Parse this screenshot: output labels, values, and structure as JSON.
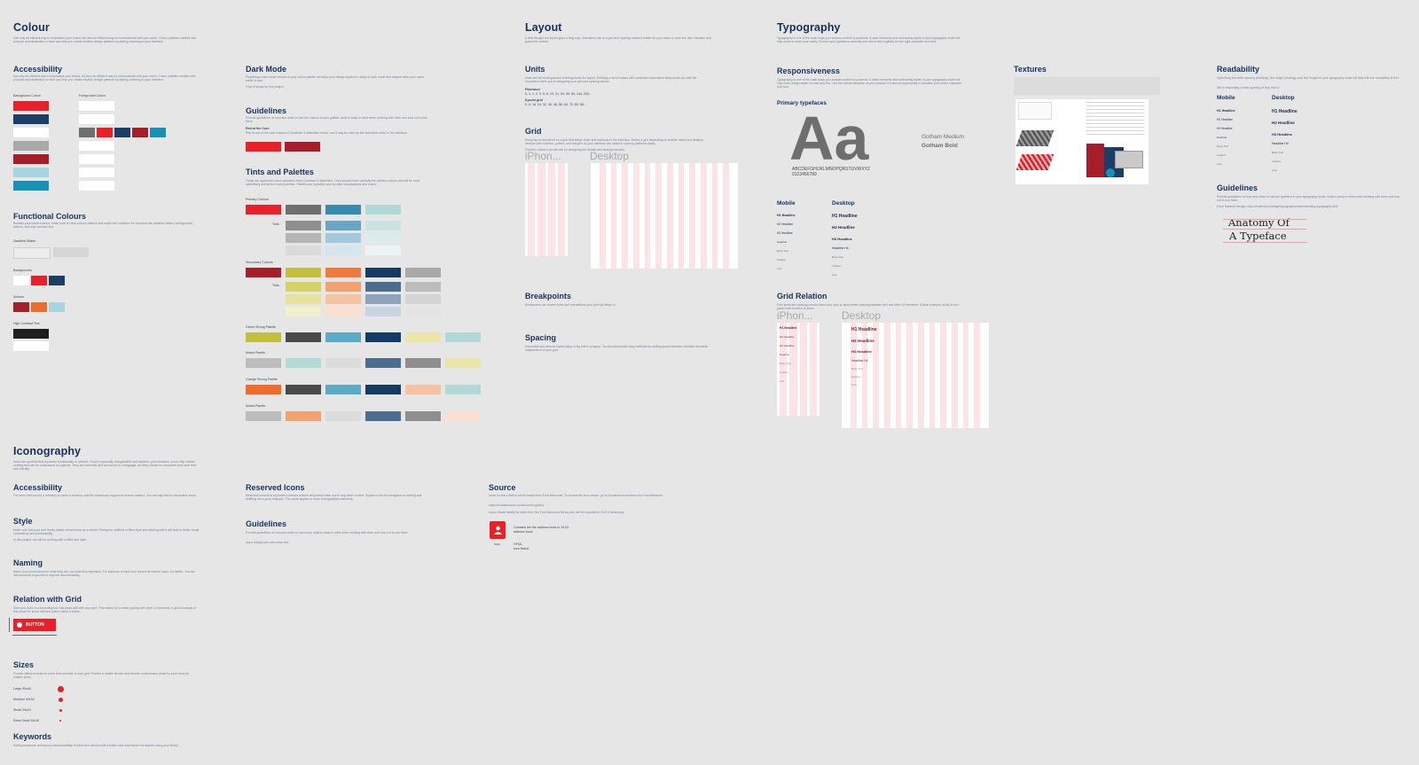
{
  "colour": {
    "title": "Colour",
    "desc": "Use only an efficient way to emphasise your brand, but also an efficient way to communicate with your users. Colour palettes created with purpose and aesthetics in mind can help you create intuitive design patterns by adding meaning to your interface.",
    "accessibility": {
      "title": "Accessibility",
      "desc": "Not only an efficient way to emphasise your brand, but also an efficient way to communicate with your users. Colour palettes created with purpose and aesthetics in mind can help you create intuitive design patterns by adding meaning to your interface.",
      "bg_label": "Background Colour",
      "fg_label": "Foreground Colour",
      "bg_colours": [
        "#e8202a",
        "#1a3e66",
        "#ffffff",
        "#a9a9a9",
        "#a61e2a",
        "#a6d4e0",
        "#1591b6"
      ],
      "combo_colours": [
        "#6f6f6f",
        "#e8202a",
        "#1a3e66",
        "#a61e2a",
        "#1591b6"
      ]
    },
    "functional": {
      "title": "Functional Colours",
      "desc": "Besides your brand colours, make sure to have colours defined and made into variables for functions like disabled states, backgrounds, actions, and high contrast text.",
      "disabled_label": "Disabled States",
      "backgrounds_label": "Backgrounds",
      "actions_label": "Actions",
      "high_contrast_label": "High Contrast Text"
    },
    "dark_mode": {
      "title": "Dark Mode",
      "desc": "Preparing a dark mode version of your colour palette will allow your design system to adapt to dark mode and respect what your users prefer to see.",
      "note": "*Out of scope for this project"
    },
    "guidelines": {
      "title": "Guidelines",
      "desc": "Provide guidelines on how and when to use the colours in your palette, what to keep in mind when working with them and how not to use them.",
      "sub_title": "Red at the Core",
      "sub_desc": "Red is one of the core colours of Cushman & Wakefield brand, and it may be used as the dominant colour in the interface."
    },
    "tints": {
      "title": "Tints and Palettes",
      "desc": "These are approved colour variations from Cushman & Wakefield. They should cover carefully the primary colours and will be most specifically across the brand palettes. Palettes are typically used for data visualisations and charts.",
      "primary_label": "Primary Colours",
      "tints_label": "Tints",
      "secondary_label": "Secondary Colours",
      "tints2_label": "Tints",
      "p1_label": "Green Strong Palette",
      "p2_label": "Muted Palette",
      "p3_label": "Orange Strong Palette",
      "p4_label": "Muted Palette"
    }
  },
  "layout": {
    "title": "Layout",
    "desc": "A well thought out layout goes a long way. Consistent use of a grid and spacing makes it easier for your users to scan the user interface and grasp the content.",
    "units": {
      "title": "Units",
      "desc": "Units are the most granular building blocks for layout. Defining a set of values with consistent increments will provide you with the foundation when you're designing your grid and spacing values.",
      "fib_label": "Fibonacci",
      "fib_values": "0, 1, 1, 2, 3, 5, 8, 13, 21, 34, 55, 89, 144, 233...",
      "base_label": "8-point grid",
      "base_values": "0, 8, 16, 24, 32, 40, 48, 56, 64, 72, 80, 88..."
    },
    "grid": {
      "title": "Grid",
      "desc": "Every layout should sit on a grid that brings order and harmony to the interface. Define a grid depending on mobile, tablet and desktop devices with columns, gutters, and margins so your interface can adapt to various platforms easily.",
      "note": "Find the columns we will use for designing the mobile and desktop devices.",
      "iphone_label": "iPhon...",
      "desktop_label": "Desktop"
    },
    "breakpoints": {
      "title": "Breakpoints",
      "desc": "Breakpoints are screen sizes and orientations your grid will adapt to."
    },
    "spacing": {
      "title": "Spacing",
      "desc": "Horizontal and vertical rhythm plays a big role in a layout. You should provide easy methods for adding space between interface elements independent of your grid."
    }
  },
  "typography": {
    "title": "Typography",
    "desc": "Typography is one of the main ways you surface content to products. A clear hierarchy and contrasting styles in your typography scale will help users to read more easily. Choose your typefaces carefully and check their legibility for the right character and tone.",
    "responsiveness": {
      "title": "Responsiveness",
      "desc": "Typography is one of the main ways you surface content to products. A clear hierarchy and contrasting styles in your typography scale will help make things easier to read and find. Use the overall structure of your product. It's also an opportunity to visualise your brand character and tone.",
      "primary_label": "Primary typefaces",
      "sample": "Aa",
      "alphabet": "ABCDEFGHIJKLMNOPQRSTUVWXYZ",
      "digits": "0123456789",
      "weight1": "Gotham Medium",
      "weight2": "Gotham Bold",
      "mobile_label": "Mobile",
      "desktop_label": "Desktop",
      "mobile_items": [
        "H1 Headline",
        "H2 Headline",
        "H3 Headline",
        "Overline",
        "Body Text",
        "Caption",
        "Link"
      ],
      "desktop_items": [
        "H1 Headline",
        "H2 Headline",
        "H3 Headline",
        "Headline H4",
        "Body Text",
        "Caption",
        "Link"
      ]
    },
    "grid_relation": {
      "title": "Grid Relation",
      "desc": "Font sizes and spacing should match your grid to allow better spacing between text and other UI elements. A clear example of this is text paired with borders or icons.",
      "iphone_label": "iPhon...",
      "desktop_label": "Desktop",
      "mobile_items": [
        "H1 Headline",
        "H2 Headline",
        "H3 Headline",
        "Overline",
        "Body Text",
        "Caption",
        "Link"
      ],
      "desktop_items": [
        "H1 Headline",
        "H2 Headline",
        "H3 Headline",
        "Headline H4",
        "Body Text",
        "Caption",
        "Link"
      ]
    },
    "textures": {
      "title": "Textures"
    },
    "readability": {
      "title": "Readability",
      "desc": "Optimising the letter-spacing (tracking), line height (leading), and line length for your typography scale will help with the readability of text.",
      "note": "We're respecting a letter spacing of less than 0.",
      "mobile_label": "Mobile",
      "desktop_label": "Desktop",
      "mobile_items": [
        "H1 Headline",
        "H2 Headline",
        "H3 Headline",
        "Overline",
        "Body Text",
        "Caption",
        "Link"
      ],
      "desktop_items": [
        "H1 Headline",
        "H2 Headline",
        "H3 Headline",
        "Headline H4",
        "Body Text",
        "Caption",
        "Link"
      ]
    },
    "guidelines": {
      "title": "Guidelines",
      "desc": "Provide guidelines on how and when to use the typeface in your typography scale, what to keep in mind when working with them and how not to use them.",
      "link": "From Material Design: https://material.io/design/typography/understanding-typography.html",
      "anatomy_line1": "Anatomy Of",
      "anatomy_line2": "A Typeface"
    }
  },
  "iconography": {
    "title": "Iconography",
    "desc": "Icons are symbols that represent functionality or content. They're especially recognisable and helpful in your interface. Icons help reduce reading and can be understood at a glance. They are universal and not bound to a language, but they should be consistent and have their own identity.",
    "accessibility": {
      "title": "Accessibility",
      "desc": "For icons that convey a meaning or serve a function, add the necessary support for screen readers. You can skip this for decorative icons."
    },
    "style": {
      "title": "Style",
      "desc": "Make sure that your icon family makes visual sense as a whole. Picking an outlined or filled style and sticking with it will lead to better visual consistency and predictability.",
      "note": "In this project, we will be working with a filled icon style."
    },
    "naming": {
      "title": "Naming",
      "desc": "Name your icons based on what they are, not what they represent. For instance, a trash icon should be named trash, not delete. You can add semantic keywords to improve discoverability."
    },
    "relation": {
      "title": "Relation with Grid",
      "desc": "Size your icons in a bounding box that plays well with your grid. This makes for a better pairing with other UI elements. A good example of this would be icons with text paired within a button.",
      "button_label": "BUTTON"
    },
    "sizes": {
      "title": "Sizes",
      "desc": "Provide different sizes for icons that correlate to your grid. Provide a mobile all size and remove unnecessary detail for your icons for smaller sizes.",
      "items": [
        "Large 40x40",
        "Medium 32x32",
        "Small 24x24",
        "Extra Small 16x16"
      ]
    },
    "keywords": {
      "title": "Keywords",
      "desc": "Adding keywords will improve discoverability of each icon and provide a better user experience for anyone using your library."
    },
    "reserved": {
      "title": "Reserved Icons",
      "desc": "Reserved icons that represent common actions will prevent their use in any other context. System icons for navigation or adding and deleting are a good example. The same applies to more iconographies elements."
    },
    "guidelines": {
      "title": "Guidelines",
      "desc": "Provide guidelines on how and when to use icons, what to keep in mind when working with them and how not to use them.",
      "note": "Icons should pair with every link."
    },
    "source": {
      "title": "Source",
      "desc": "Icons for this solution will be based from Font Awesome. To access the icon vendor, go to Document and search for Font Awesome.",
      "link": "https://fontawesome.com/icons?d=gallery",
      "note": "Icons should ideally be taken from the Font Awesome library and will be exported to SVG if necessary.",
      "sample_line1": "Contains the file address book in 14:24",
      "sample_line2": "address book",
      "icon_label": "Icon",
      "format_label": "HTML",
      "format_value": "Icon Name"
    }
  },
  "colors": {
    "bg": "#e6e6e6",
    "title": "#16325c",
    "accent": "#e8202a"
  }
}
